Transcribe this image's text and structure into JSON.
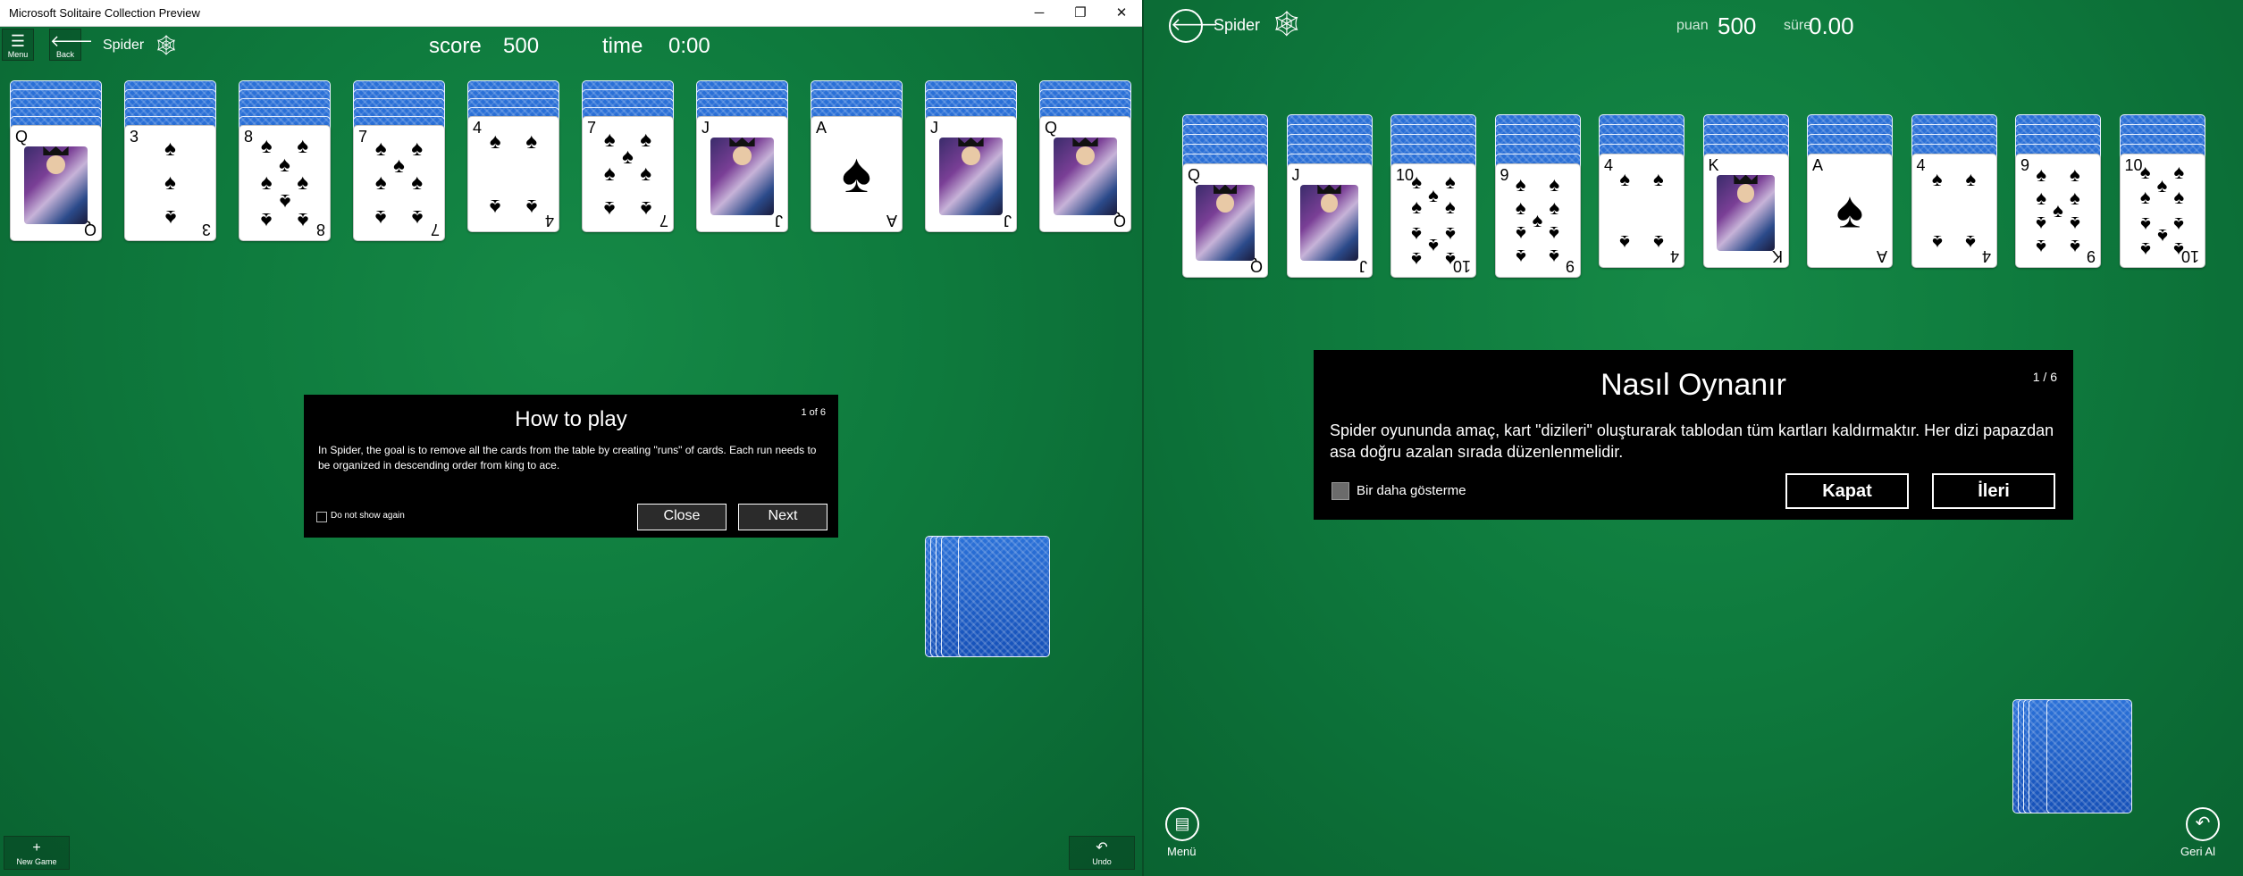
{
  "left_window": {
    "title": "Microsoft Solitaire Collection Preview",
    "controls": {
      "minimize": "─",
      "restore": "❐",
      "close": "✕"
    },
    "menu_label": "Menu",
    "back_label": "Back",
    "game_name": "Spider",
    "score_label": "score",
    "score_value": "500",
    "time_label": "time",
    "time_value": "0:00",
    "columns": [
      {
        "rank": "Q",
        "suit": "♠"
      },
      {
        "rank": "3",
        "suit": "♠"
      },
      {
        "rank": "8",
        "suit": "♠"
      },
      {
        "rank": "7",
        "suit": "♠"
      },
      {
        "rank": "4",
        "suit": "♠"
      },
      {
        "rank": "7",
        "suit": "♠"
      },
      {
        "rank": "J",
        "suit": "♠"
      },
      {
        "rank": "A",
        "suit": "♠"
      },
      {
        "rank": "J",
        "suit": "♠"
      },
      {
        "rank": "Q",
        "suit": "♠"
      }
    ],
    "dialog": {
      "title": "How to play",
      "page": "1 of 6",
      "body": "In Spider, the goal is to remove all the cards from the table by creating \"runs\" of cards.  Each run needs to be organized in descending order from king to ace.",
      "checkbox_label": "Do not show again",
      "close_label": "Close",
      "next_label": "Next"
    },
    "new_game_label": "New Game",
    "undo_label": "Undo"
  },
  "right_window": {
    "game_name": "Spider",
    "score_label": "puan",
    "score_value": "500",
    "time_label": "süre",
    "time_value": "0.00",
    "columns": [
      {
        "rank": "Q",
        "suit": "♠"
      },
      {
        "rank": "J",
        "suit": "♠"
      },
      {
        "rank": "10",
        "suit": "♠"
      },
      {
        "rank": "9",
        "suit": "♠"
      },
      {
        "rank": "4",
        "suit": "♠"
      },
      {
        "rank": "K",
        "suit": "♠"
      },
      {
        "rank": "A",
        "suit": "♠"
      },
      {
        "rank": "4",
        "suit": "♠"
      },
      {
        "rank": "9",
        "suit": "♠"
      },
      {
        "rank": "10",
        "suit": "♠"
      }
    ],
    "dialog": {
      "title": "Nasıl Oynanır",
      "page": "1 / 6",
      "body": "Spider oyununda amaç, kart \"dizileri\" oluşturarak tablodan tüm kartları kaldırmaktır.  Her dizi papazdan asa doğru azalan sırada düzenlenmelidir.",
      "checkbox_label": "Bir daha gösterme",
      "close_label": "Kapat",
      "next_label": "İleri"
    },
    "menu_label": "Menü",
    "undo_label": "Geri Al"
  },
  "colors": {
    "felt": "#0e7a3d",
    "card_back": "#1e5fc8",
    "dialog_bg": "#000000"
  },
  "icons": {
    "hamburger": "☰",
    "back_arrow": "🡐",
    "spider_web": "🕸",
    "plus": "+",
    "undo": "↶",
    "menu_book": "▤"
  }
}
